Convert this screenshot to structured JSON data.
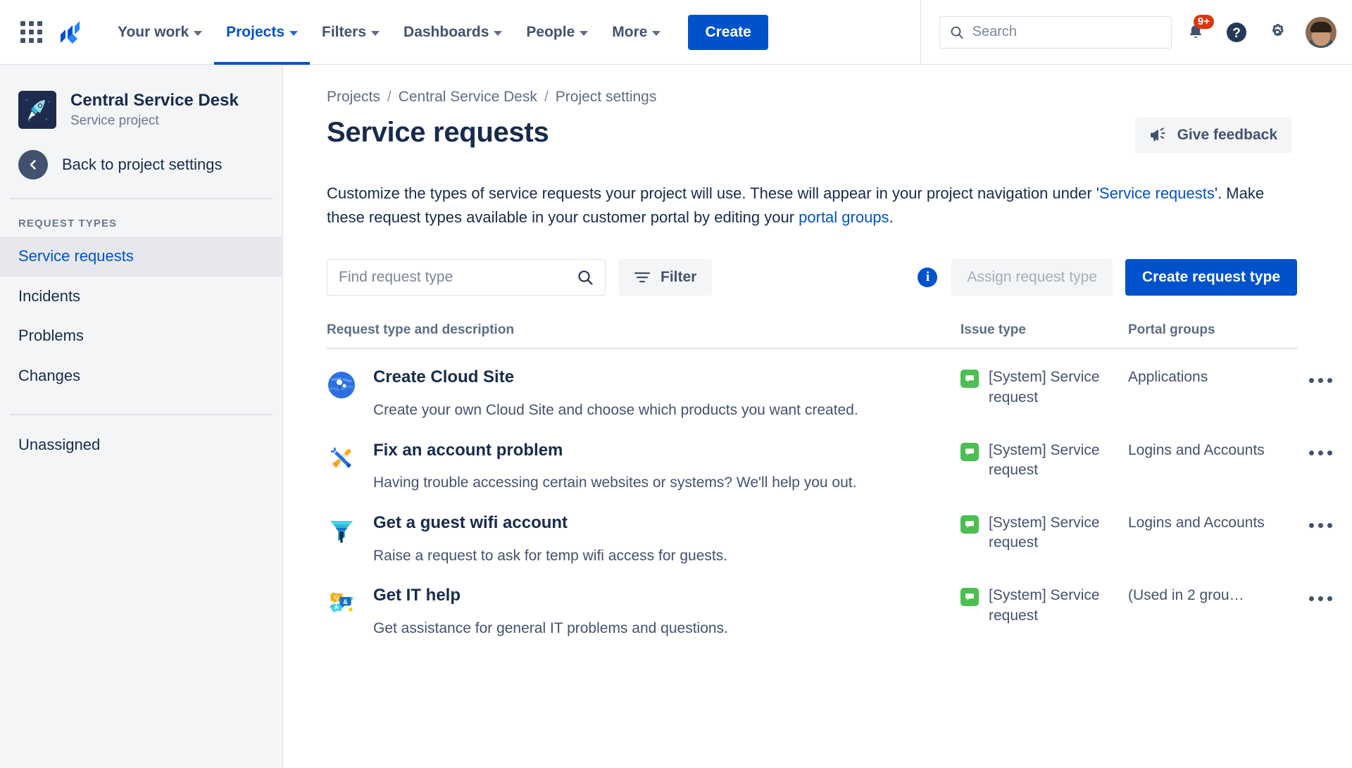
{
  "topnav": {
    "app_switcher": "app-switcher",
    "logo": "jira-logo",
    "items": [
      {
        "label": "Your work",
        "active": false
      },
      {
        "label": "Projects",
        "active": true
      },
      {
        "label": "Filters",
        "active": false
      },
      {
        "label": "Dashboards",
        "active": false
      },
      {
        "label": "People",
        "active": false
      },
      {
        "label": "More",
        "active": false
      }
    ],
    "create_label": "Create",
    "search_placeholder": "Search",
    "search_value": "",
    "notifications_badge": "9+",
    "help_label": "?",
    "settings_label": "settings"
  },
  "sidebar": {
    "project_name": "Central Service Desk",
    "project_type": "Service project",
    "back_label": "Back to project settings",
    "section_title": "REQUEST TYPES",
    "items": [
      {
        "label": "Service requests",
        "active": true
      },
      {
        "label": "Incidents",
        "active": false
      },
      {
        "label": "Problems",
        "active": false
      },
      {
        "label": "Changes",
        "active": false
      }
    ],
    "unassigned_label": "Unassigned"
  },
  "breadcrumb": [
    "Projects",
    "Central Service Desk",
    "Project settings"
  ],
  "page": {
    "title": "Service requests",
    "feedback_label": "Give feedback",
    "description_part1": "Customize the types of service requests your project will use. These will appear in your project navigation under '",
    "description_link1": "Service requests",
    "description_part2": "'. Make these request types available in your customer portal by editing your ",
    "description_link2": "portal groups",
    "description_part3": "."
  },
  "toolbar": {
    "find_placeholder": "Find request type",
    "find_value": "",
    "filter_label": "Filter",
    "info_label": "i",
    "assign_label": "Assign request type",
    "create_label": "Create request type"
  },
  "table": {
    "headers": {
      "request_type": "Request type and description",
      "issue_type": "Issue type",
      "portal_groups": "Portal groups"
    },
    "rows": [
      {
        "icon": "cloud-globe-icon",
        "name": "Create Cloud Site",
        "description": "Create your own Cloud Site and choose which products you want created.",
        "issue_type": "[System] Service request",
        "portal_groups": "Applications",
        "more_label": "more-actions"
      },
      {
        "icon": "tools-icon",
        "name": "Fix an account problem",
        "description": "Having trouble accessing certain websites or systems? We'll help you out.",
        "issue_type": "[System] Service request",
        "portal_groups": "Logins and Accounts",
        "more_label": "more-actions"
      },
      {
        "icon": "funnel-icon",
        "name": "Get a guest wifi account",
        "description": "Raise a request to ask for temp wifi access for guests.",
        "issue_type": "[System] Service request",
        "portal_groups": "Logins and Accounts",
        "more_label": "more-actions"
      },
      {
        "icon": "qa-bubbles-icon",
        "name": "Get IT help",
        "description": "Get assistance for general IT problems and questions.",
        "issue_type": "[System] Service request",
        "portal_groups": "(Used in 2 grou…",
        "more_label": "more-actions"
      }
    ]
  },
  "colors": {
    "brand_blue": "#0052CC",
    "link_blue": "#0052CC",
    "text_dark": "#172B4D",
    "text_muted": "#5E6C84",
    "sidebar_bg": "#F4F5F7",
    "selected_bg": "#E6E8ED",
    "badge_red": "#DE350B",
    "issue_green": "#4BBF51"
  }
}
